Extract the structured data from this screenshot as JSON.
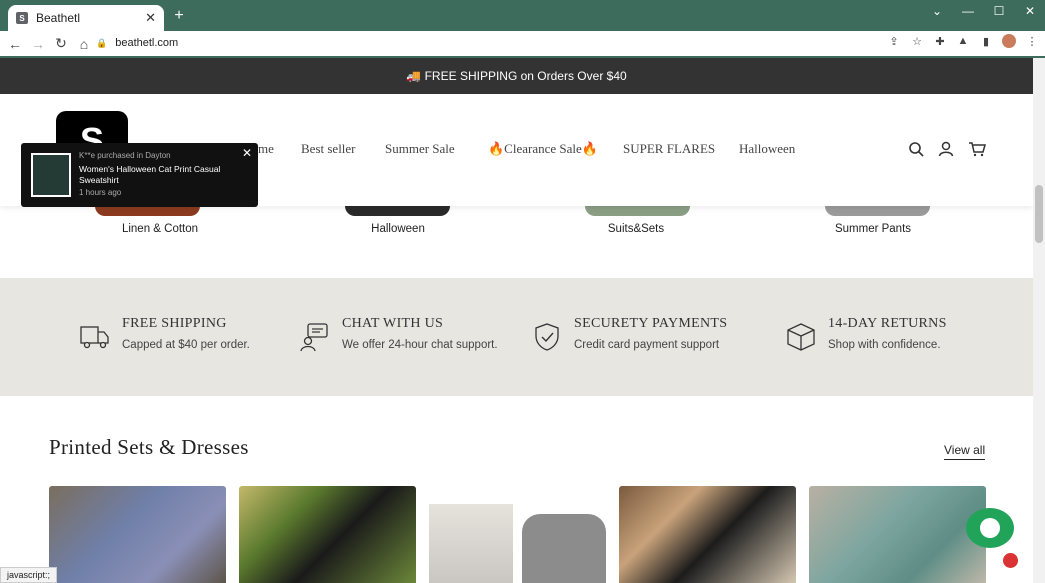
{
  "browser": {
    "tab_title": "Beathetl",
    "url": "beathetl.com",
    "status_text": "javascript:;"
  },
  "announcement": "🚚 FREE SHIPPING on Orders Over $40",
  "header": {
    "logo_letter": "S",
    "nav": [
      "me",
      "Best seller",
      "Summer Sale",
      "🔥Clearance Sale🔥",
      "SUPER FLARES",
      "Halloween"
    ]
  },
  "categories": [
    "Linen & Cotton",
    "Halloween",
    "Suits&Sets",
    "Summer Pants"
  ],
  "features": [
    {
      "title": "FREE SHIPPING",
      "subtitle": "Capped at $40 per order."
    },
    {
      "title": "CHAT WITH US",
      "subtitle": "We offer 24-hour chat support."
    },
    {
      "title": "SECURETY PAYMENTS",
      "subtitle": "Credit card payment support"
    },
    {
      "title": "14-DAY RETURNS",
      "subtitle": "Shop with confidence."
    }
  ],
  "section": {
    "title": "Printed Sets & Dresses",
    "view_all": "View all"
  },
  "popup": {
    "who": "K**e purchased in Dayton",
    "product": "Women's Halloween Cat Print Casual Sweatshirt",
    "time": "1 hours ago"
  },
  "icons": {
    "tab_favicon": "brand-favicon-icon",
    "new_tab": "plus-icon",
    "back": "back-arrow-icon",
    "forward": "forward-arrow-icon",
    "reload": "reload-icon",
    "home": "home-icon",
    "lock": "lock-icon",
    "share": "share-icon",
    "bookmark": "star-icon",
    "extensions": "puzzle-icon",
    "extension_2": "extension-icon",
    "sidebar": "sidebar-icon",
    "menu": "kebab-menu-icon",
    "search": "search-icon",
    "account": "user-icon",
    "cart": "cart-icon",
    "truck": "truck-icon",
    "chat": "chat-icon",
    "shield": "shield-check-icon",
    "box": "box-icon"
  },
  "colors": {
    "chrome": "#3d6b5c",
    "announcement_bg": "#333333",
    "features_bg": "#e8e6e1",
    "chat": "#21a35a"
  }
}
